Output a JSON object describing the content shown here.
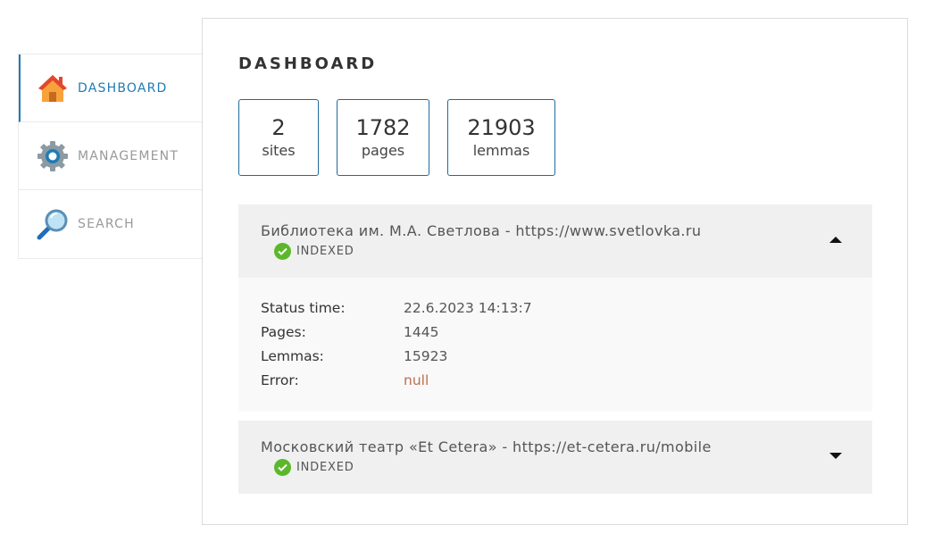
{
  "sidebar": {
    "items": [
      {
        "label": "DASHBOARD",
        "icon": "home-icon",
        "active": true
      },
      {
        "label": "MANAGEMENT",
        "icon": "gear-icon",
        "active": false
      },
      {
        "label": "SEARCH",
        "icon": "magnifier-icon",
        "active": false
      }
    ]
  },
  "main": {
    "title": "DASHBOARD",
    "stats": [
      {
        "value": "2",
        "label": "sites"
      },
      {
        "value": "1782",
        "label": "pages"
      },
      {
        "value": "21903",
        "label": "lemmas"
      }
    ],
    "sites": [
      {
        "title": "Библиотека им. М.А. Светлова - https://www.svetlovka.ru",
        "status": "INDEXED",
        "expanded": true,
        "details": {
          "status_time_label": "Status time:",
          "status_time": "22.6.2023 14:13:7",
          "pages_label": "Pages:",
          "pages": "1445",
          "lemmas_label": "Lemmas:",
          "lemmas": "15923",
          "error_label": "Error:",
          "error": "null"
        }
      },
      {
        "title": "Московский театр «Et Cetera» - https://et-cetera.ru/mobile",
        "status": "INDEXED",
        "expanded": false
      }
    ]
  },
  "colors": {
    "accent": "#1f7bb5",
    "stat_border": "#1f6b9a",
    "status_ok": "#5cb82b",
    "error_value": "#b5704e"
  }
}
